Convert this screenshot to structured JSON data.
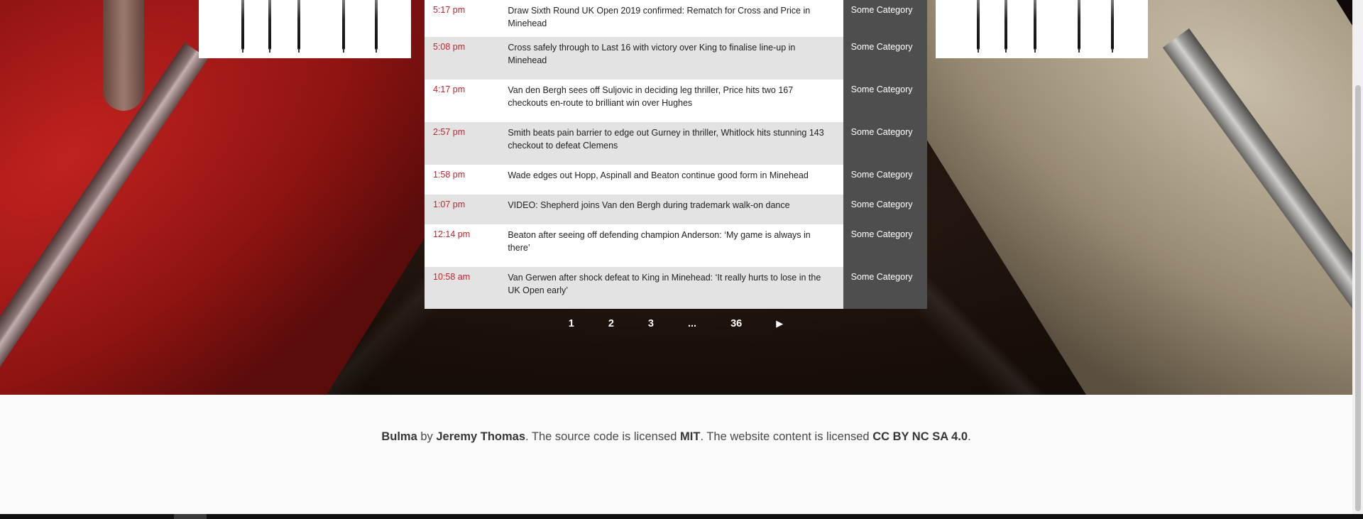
{
  "news": [
    {
      "time": "5:17 pm",
      "headline": "Draw Sixth Round UK Open 2019 confirmed: Rematch for Cross and Price in Minehead",
      "category": "Some Category"
    },
    {
      "time": "5:08 pm",
      "headline": "Cross safely through to Last 16 with victory over King to finalise line-up in Minehead",
      "category": "Some Category"
    },
    {
      "time": "4:17 pm",
      "headline": "Van den Bergh sees off Suljovic in deciding leg thriller, Price hits two 167 checkouts en-route to brilliant win over Hughes",
      "category": "Some Category"
    },
    {
      "time": "2:57 pm",
      "headline": "Smith beats pain barrier to edge out Gurney in thriller, Whitlock hits stunning 143 checkout to defeat Clemens",
      "category": "Some Category"
    },
    {
      "time": "1:58 pm",
      "headline": "Wade edges out Hopp, Aspinall and Beaton continue good form in Minehead",
      "category": "Some Category"
    },
    {
      "time": "1:07 pm",
      "headline": "VIDEO: Shepherd joins Van den Bergh during trademark walk-on dance",
      "category": "Some Category"
    },
    {
      "time": "12:14 pm",
      "headline": "Beaton after seeing off defending champion Anderson: ‘My game is always in there’",
      "category": "Some Category"
    },
    {
      "time": "10:58 am",
      "headline": "Van Gerwen after shock defeat to King in Minehead: ‘It really hurts to lose in the UK Open early’",
      "category": "Some Category"
    }
  ],
  "pagination": {
    "pages": [
      "1",
      "2",
      "3",
      "...",
      "36"
    ],
    "next_icon": "next-arrow-icon",
    "next_glyph": "▶"
  },
  "footer": {
    "brand": "Bulma",
    "by": " by ",
    "author": "Jeremy Thomas",
    "text1": ". The source code is licensed ",
    "license_code": "MIT",
    "text2": ". The website content is licensed ",
    "license_content": "CC BY NC SA 4.0",
    "text3": "."
  },
  "colors": {
    "time_red": "#c0252b",
    "category_bg": "#4e4e4e",
    "row_alt": "#e3e3e3"
  }
}
